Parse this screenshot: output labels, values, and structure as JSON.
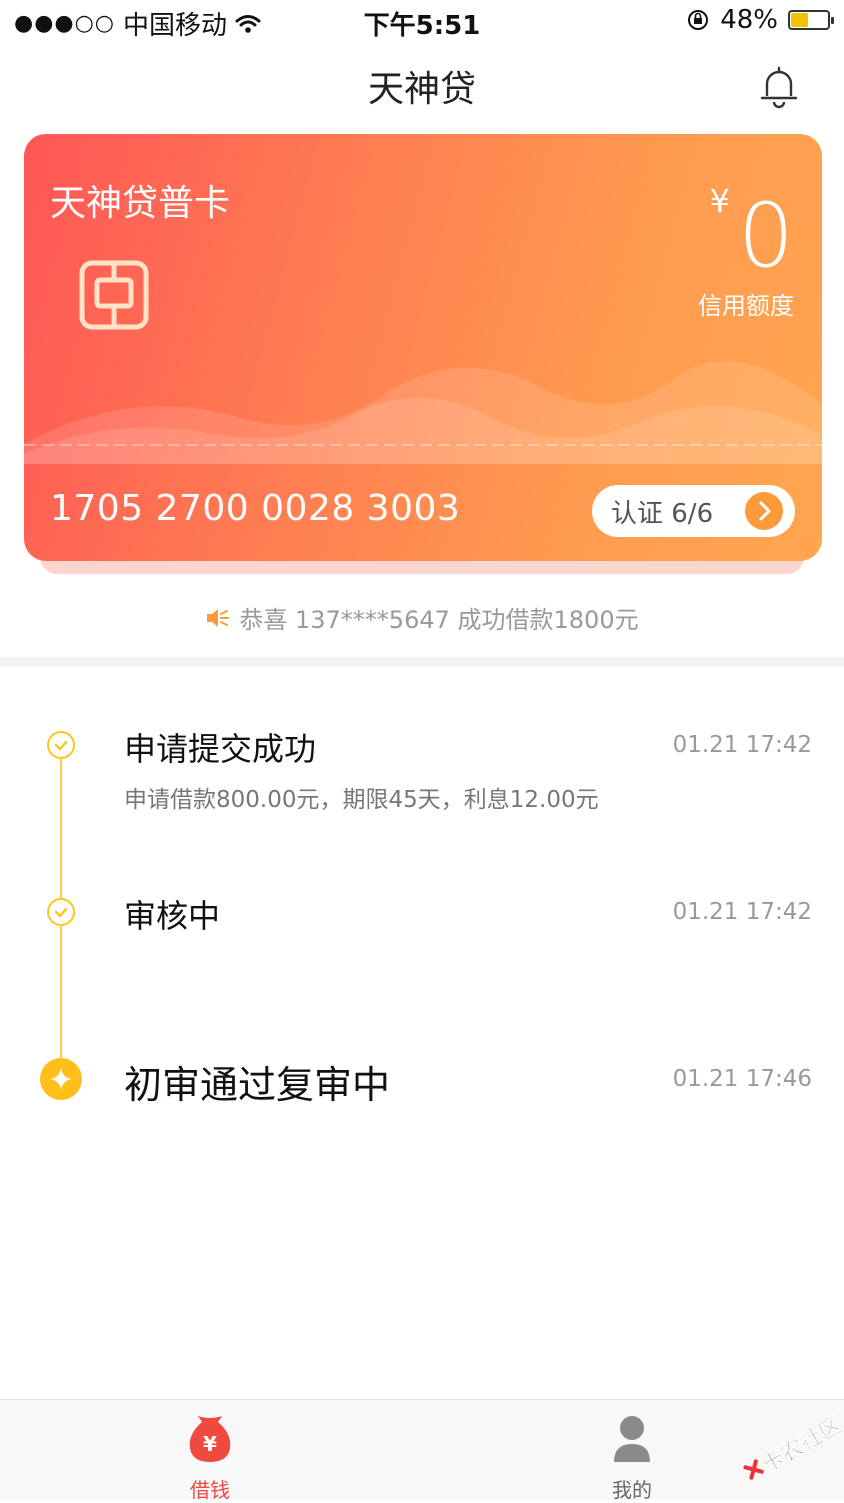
{
  "status_bar": {
    "signal": "●●●○○",
    "carrier": "中国移动",
    "time": "下午5:51",
    "battery_percent": "48%",
    "battery_level": 0.48
  },
  "header": {
    "title": "天神贷"
  },
  "card": {
    "name": "天神贷普卡",
    "currency_symbol": "¥",
    "credit_limit": "0",
    "credit_limit_label": "信用额度",
    "card_number": "1705 2700 0028 3003",
    "verify_label": "认证 6/6"
  },
  "notice": {
    "text": "恭喜 137****5647 成功借款1800元"
  },
  "timeline": [
    {
      "title": "申请提交成功",
      "time": "01.21 17:42",
      "desc": "申请借款800.00元，期限45天，利息12.00元"
    },
    {
      "title": "审核中",
      "time": "01.21 17:42"
    },
    {
      "title": "初审通过复审中",
      "time": "01.21 17:46"
    }
  ],
  "tabbar": {
    "items": [
      {
        "label": "借钱",
        "active": true
      },
      {
        "label": "我的",
        "active": false
      }
    ]
  },
  "watermark": {
    "text": "卡农社区"
  },
  "colors": {
    "accent_orange": "#ff9a3a",
    "card_gradient_start": "#ff5656",
    "card_gradient_end": "#ffa64f",
    "timeline_yellow": "#ffc51f",
    "tab_active": "#f04a40"
  }
}
